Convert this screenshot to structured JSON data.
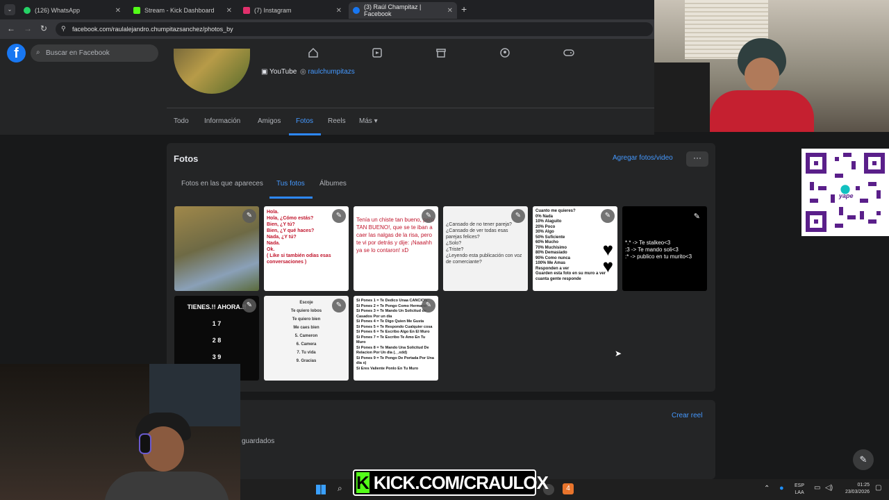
{
  "browser": {
    "tabs": [
      {
        "label": "(126) WhatsApp",
        "color": "#25d366"
      },
      {
        "label": "Stream - Kick Dashboard",
        "color": "#53fc18"
      },
      {
        "label": "(7) Instagram",
        "color": "#e1306c"
      },
      {
        "label": "(3) Raúl Champitaz | Facebook",
        "color": "#1877f2"
      }
    ],
    "url": "facebook.com/raulalejandro.chumpitazsanchez/photos_by"
  },
  "fb": {
    "logo": "f",
    "search_placeholder": "Buscar en Facebook",
    "nav_icons": [
      "home-icon",
      "video-icon",
      "marketplace-icon",
      "groups-icon",
      "gaming-icon"
    ]
  },
  "profile": {
    "youtube_label": "YouTube",
    "instagram_handle": "raulchumpitazs",
    "tabs": [
      "Todo",
      "Información",
      "Amigos",
      "Fotos",
      "Reels",
      "Más ▾"
    ],
    "active_tab": "Fotos"
  },
  "photos": {
    "title": "Fotos",
    "add_label": "Agregar fotos/video",
    "more_label": "···",
    "subtabs": [
      "Fotos en las que apareces",
      "Tus fotos",
      "Álbumes"
    ],
    "active_subtab": "Tus fotos",
    "items": [
      {
        "bg": "#8a7a50",
        "text": ""
      },
      {
        "bg": "#ffffff",
        "text": "Hola.\nHola, ¿Cómo estás?\nBien, ¿Y tú?\nBien, ¿Y qué haces?\nNada, ¿Y tú?\nNada.\nOk.\n( Like si también odias esas conversaciones )"
      },
      {
        "bg": "#ffffff",
        "text": "Tenía un chiste tan bueno, pero TAN BUENO!, que se te iban a caer las nalgas de la risa, pero te vi por detrás y dije: ¡Naaahh ya se lo contaron! xD"
      },
      {
        "bg": "#f2f2f2",
        "text": "¿Cansado de no tener pareja?\n¿Cansado de ver todas esas parejas felices?\n¿Solo?\n¿Triste?\n¿Leyendo esta publicación con voz de comerciante?"
      },
      {
        "bg": "#ffffff",
        "text": "Cuanto me quieres?\n0% Nada\n10% Alaguito\n20% Poco\n30% Algo\n50% Suficiente\n60% Mucho\n70% Muchisimo\n80% Demasiado\n90% Como nunca\n100% Me Amas\nResponden a ver\nGuarden esta foto en su muro a ver cuanta gente responde"
      },
      {
        "bg": "#000000",
        "text": "*.* -> Te stalkeo<3\n:3 -> Te mando soli<3\n:* -> publico en tu murito<3"
      },
      {
        "bg": "#0a0a0a",
        "text": "TIENES.!! AHORA.!!\n1   7\n2   8\n3   9\n4   10"
      },
      {
        "bg": "#f4f4f4",
        "text": "Escoje\nTe quiero lobos\nTe quiero bien\nMe caes bien\n5. Cameron\n6. Camera\n7. Tu vida\n9. Gracias"
      },
      {
        "bg": "#ffffff",
        "text": "Si Pones 1 = Te Dedico Unaa CANCION\nSi Pones 2 = Te Pongo Como Hermano\nSi Pones 3 = Te Mando Un Solicitud de Casados Por un dia\nSi Pones 4 = Te Digo Quien Me Gusta\nSi Pones 5 = Te Respondo Cualquier cosa\nSi Pones 6 = Te Escribo Algo En El Muro\nSi Pones 7 = Te Escribo Te Amo En Tu Muro\nSi Pones 8 = Te Mando Una Solicitud De Relacion Por Un dia (._.xdd)\nSi Pones 9 = Te Pongo De Portada Por Una dia x)\nSi Eres Valiente Ponlo En Tu Muro"
      }
    ]
  },
  "reels": {
    "create_label": "Crear reel",
    "saved_label": "guardados"
  },
  "overlay": {
    "kick_k": "K",
    "kick_text": "KICK.COM/CRAULOX",
    "qr_label": "yape"
  },
  "taskbar": {
    "lang_top": "ESP",
    "lang_bottom": "LAA",
    "time": "01:25",
    "date": "23/03/2026"
  },
  "colors": {
    "accent": "#2d88ff",
    "fb_blue": "#1877f2",
    "kick_green": "#53fc18"
  }
}
